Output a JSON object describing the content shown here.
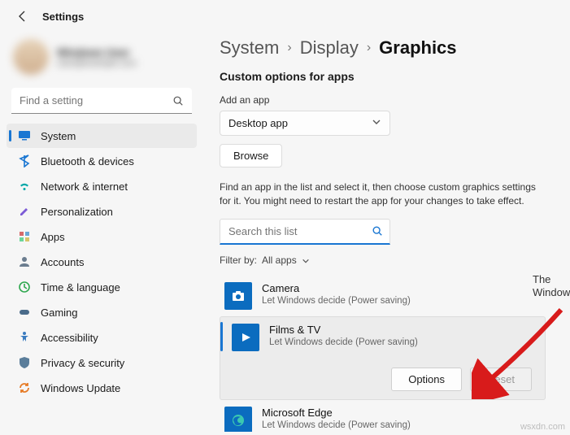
{
  "topbar": {
    "title": "Settings"
  },
  "profile": {
    "name": "Windows User",
    "email": "user@example.com"
  },
  "search": {
    "placeholder": "Find a setting"
  },
  "sidebar": {
    "items": [
      {
        "label": "System",
        "icon": "monitor",
        "color": "#1976d2",
        "active": true
      },
      {
        "label": "Bluetooth & devices",
        "icon": "bluetooth",
        "color": "#1976d2"
      },
      {
        "label": "Network & internet",
        "icon": "wifi",
        "color": "#00a8a8"
      },
      {
        "label": "Personalization",
        "icon": "brush",
        "color": "#7c5bd6"
      },
      {
        "label": "Apps",
        "icon": "grid",
        "color": "#d66b6b"
      },
      {
        "label": "Accounts",
        "icon": "person",
        "color": "#6b7d8f"
      },
      {
        "label": "Time & language",
        "icon": "clock",
        "color": "#2fa84f"
      },
      {
        "label": "Gaming",
        "icon": "gamepad",
        "color": "#4a6b8a"
      },
      {
        "label": "Accessibility",
        "icon": "accessibility",
        "color": "#3a7bbf"
      },
      {
        "label": "Privacy & security",
        "icon": "shield",
        "color": "#5a7d9a"
      },
      {
        "label": "Windows Update",
        "icon": "update",
        "color": "#e67b26"
      }
    ]
  },
  "breadcrumb": {
    "items": [
      "System",
      "Display",
      "Graphics"
    ]
  },
  "main": {
    "heading": "Custom options for apps",
    "add_label": "Add an app",
    "app_type_selected": "Desktop app",
    "browse_label": "Browse",
    "help_text": "Find an app in the list and select it, then choose custom graphics settings for it. You might need to restart the app for your changes to take effect.",
    "search_placeholder": "Search this list",
    "filter_label": "Filter by:",
    "filter_value": "All apps",
    "apps": [
      {
        "name": "Camera",
        "sub": "Let Windows decide (Power saving)",
        "color": "#0b6cbf",
        "selected": false
      },
      {
        "name": "Films & TV",
        "sub": "Let Windows decide (Power saving)",
        "color": "#0b6cbf",
        "selected": true
      },
      {
        "name": "Microsoft Edge",
        "sub": "Let Windows decide (Power saving)",
        "color": "#0b6cbf",
        "selected": false
      }
    ],
    "options_label": "Options",
    "reset_label": "Reset"
  },
  "watermark_overlay": {
    "line1": "The",
    "line2": "WindowsClub"
  },
  "watermark": "wsxdn.com"
}
